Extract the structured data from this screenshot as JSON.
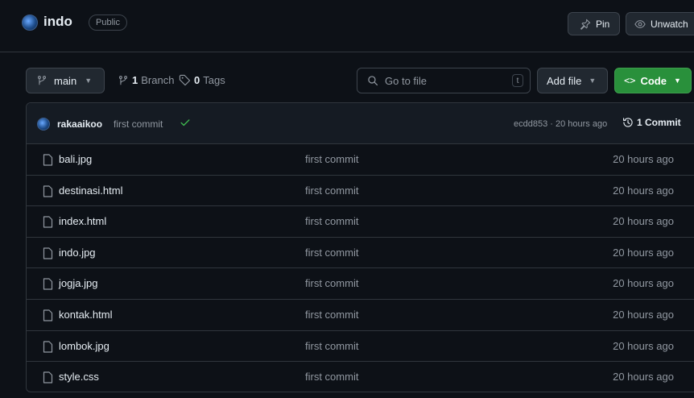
{
  "header": {
    "repo_name": "indo",
    "visibility": "Public",
    "pin_label": "Pin",
    "unwatch_label": "Unwatch"
  },
  "toolbar": {
    "branch": "main",
    "branches_count": "1",
    "branches_label": "Branch",
    "tags_count": "0",
    "tags_label": "Tags",
    "search_placeholder": "Go to file",
    "search_shortcut": "t",
    "add_file_label": "Add file",
    "code_label": "Code"
  },
  "commit": {
    "author": "rakaaikoo",
    "message": "first commit",
    "hash_time": "ecdd853 · 20 hours ago",
    "count_label": "1 Commit"
  },
  "files": [
    {
      "name": "bali.jpg",
      "commit": "first commit",
      "time": "20 hours ago"
    },
    {
      "name": "destinasi.html",
      "commit": "first commit",
      "time": "20 hours ago"
    },
    {
      "name": "index.html",
      "commit": "first commit",
      "time": "20 hours ago"
    },
    {
      "name": "indo.jpg",
      "commit": "first commit",
      "time": "20 hours ago"
    },
    {
      "name": "jogja.jpg",
      "commit": "first commit",
      "time": "20 hours ago"
    },
    {
      "name": "kontak.html",
      "commit": "first commit",
      "time": "20 hours ago"
    },
    {
      "name": "lombok.jpg",
      "commit": "first commit",
      "time": "20 hours ago"
    },
    {
      "name": "style.css",
      "commit": "first commit",
      "time": "20 hours ago"
    }
  ],
  "colors": {
    "background": "#0d1117",
    "border": "#30363d",
    "code_button": "#29903b",
    "check": "#3fb950"
  },
  "icons": [
    "repo-avatar",
    "pin-icon",
    "eye-icon",
    "git-branch-icon",
    "tag-icon",
    "search-icon",
    "check-icon",
    "history-icon",
    "file-icon"
  ]
}
